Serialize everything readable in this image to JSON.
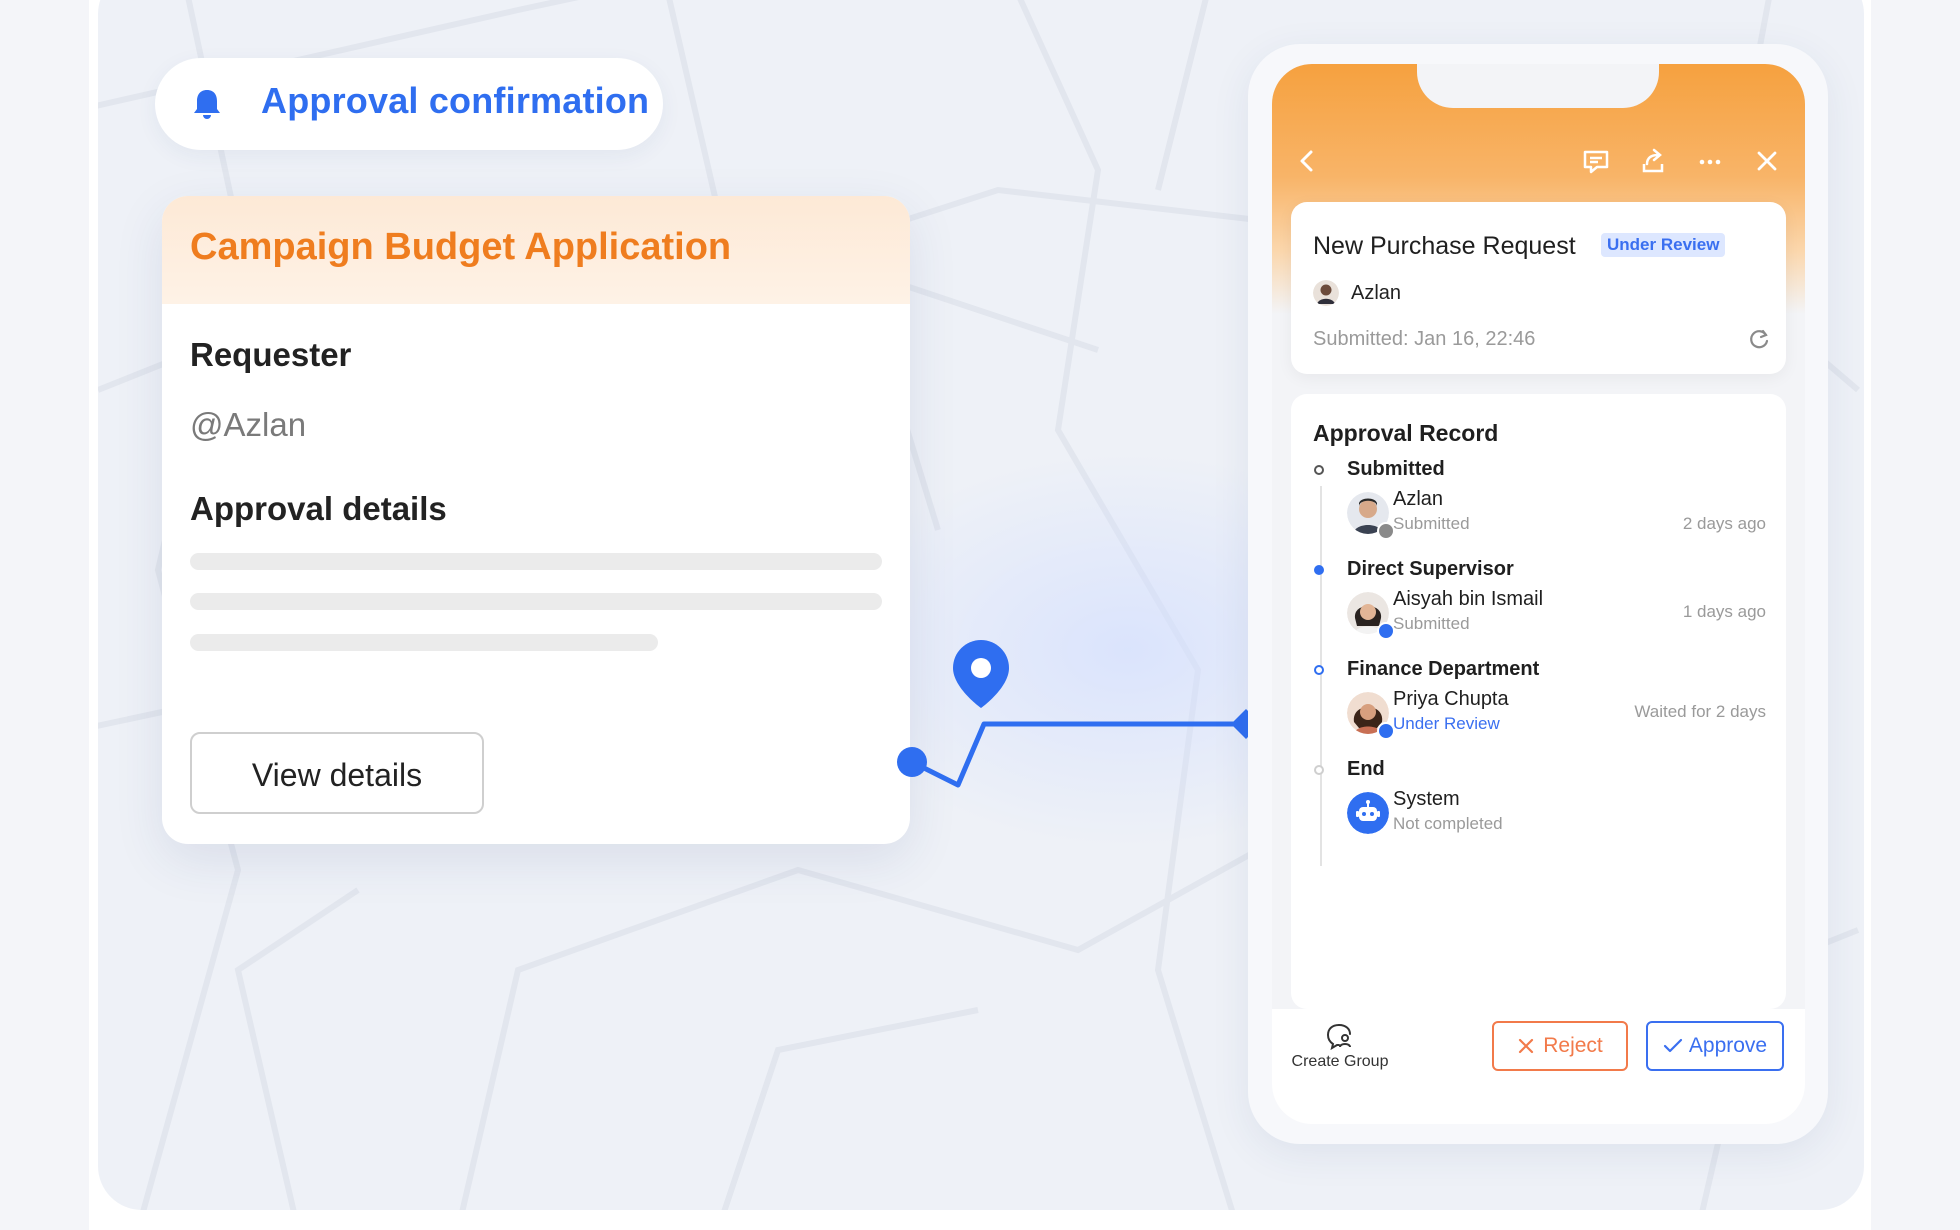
{
  "notification": {
    "title": "Approval confirmation",
    "icon": "bell-icon"
  },
  "form_card": {
    "title": "Campaign Budget Application",
    "requester_label": "Requester",
    "requester_value": "@Azlan",
    "details_label": "Approval details",
    "view_button": "View details"
  },
  "phone": {
    "toolbar_icons": [
      "back-icon",
      "comment-icon",
      "share-icon",
      "more-icon",
      "close-icon"
    ],
    "request": {
      "title": "New Purchase Request",
      "status": "Under Review",
      "user": "Azlan",
      "submitted": "Submitted: Jan 16, 22:46"
    },
    "record": {
      "title": "Approval Record",
      "steps": [
        {
          "name": "Submitted",
          "person": "Azlan",
          "status": "Submitted",
          "time": "2 days ago"
        },
        {
          "name": "Direct Supervisor",
          "person": "Aisyah bin Ismail",
          "status": "Submitted",
          "time": "1 days ago"
        },
        {
          "name": "Finance Department",
          "person": "Priya Chupta",
          "status": "Under Review",
          "time": "Waited for 2 days"
        },
        {
          "name": "End",
          "person": "System",
          "status": "Not completed",
          "time": ""
        }
      ]
    },
    "footer": {
      "create_group": "Create Group",
      "reject": "Reject",
      "approve": "Approve"
    }
  },
  "colors": {
    "accent_blue": "#2f6ef0",
    "accent_orange": "#ef7d1f",
    "reject_red": "#f27a4a"
  }
}
